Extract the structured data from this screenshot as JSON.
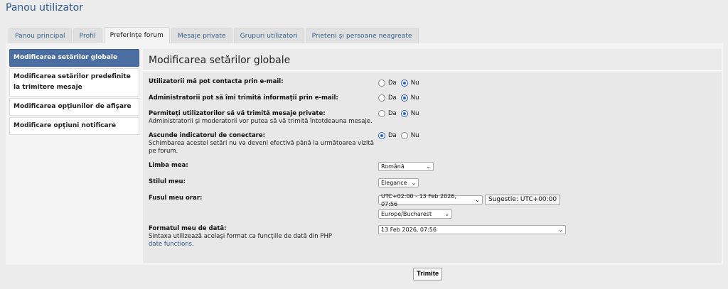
{
  "page_title": "Panou utilizator",
  "tabs": [
    {
      "label": "Panou principal"
    },
    {
      "label": "Profil"
    },
    {
      "label": "Preferinţe forum"
    },
    {
      "label": "Mesaje private"
    },
    {
      "label": "Grupuri utilizatori"
    },
    {
      "label": "Prieteni şi persoane neagreate"
    }
  ],
  "sidebar": {
    "items": [
      {
        "label": "Modificarea setărilor globale"
      },
      {
        "label": "Modificarea setărilor predefinite la trimitere mesaje"
      },
      {
        "label": "Modificarea opţiunilor de afişare"
      },
      {
        "label": "Modificare opţiuni notificare"
      }
    ]
  },
  "section_title": "Modificarea setărilor globale",
  "form": {
    "email_users": {
      "label": "Utilizatorii mă pot contacta prin e-mail:",
      "yes": "Da",
      "no": "Nu",
      "selected": "Nu"
    },
    "email_admins": {
      "label": "Administratorii pot să îmi trimită informaţii prin e-mail:",
      "yes": "Da",
      "no": "Nu",
      "selected": "Nu"
    },
    "allow_pm": {
      "label": "Permiteţi utilizatorilor să vă trimită mesaje private:",
      "desc": "Administratorii şi moderatorii vor putea să vă trimită întotdeauna mesaje.",
      "yes": "Da",
      "no": "Nu",
      "selected": "Nu"
    },
    "hide_online": {
      "label": "Ascunde indicatorul de conectare:",
      "desc": "Schimbarea acestei setări nu va deveni efectivă până la următoarea vizită pe forum.",
      "yes": "Da",
      "no": "Nu",
      "selected": "Da"
    },
    "language": {
      "label": "Limba mea:",
      "value": "Română"
    },
    "style": {
      "label": "Stilul meu:",
      "value": "Elegance"
    },
    "timezone": {
      "label": "Fusul meu orar:",
      "value": "UTC+02:00 - 13 Feb 2026, 07:56",
      "suggest_button": "Sugestie: UTC+00:00",
      "zone_value": "Europe/Bucharest"
    },
    "date_format": {
      "label": "Formatul meu de dată:",
      "desc": "Sintaxa utilizează acelaşi format ca funcţiile de dată din PHP",
      "link": "date functions",
      "link_suffix": ".",
      "value": "13 Feb 2026, 07:56"
    }
  },
  "submit_label": "Trimite",
  "colors": {
    "accent": "#4a6ea2",
    "title": "#2c5a8c",
    "radio": "#2c5bd6"
  }
}
